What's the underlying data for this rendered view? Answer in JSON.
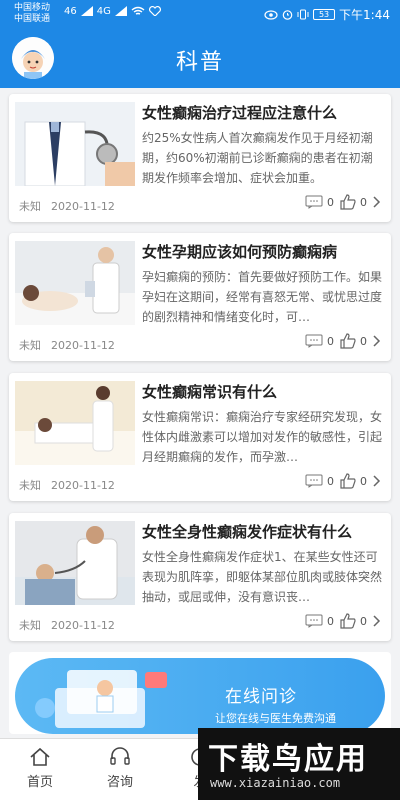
{
  "status_bar": {
    "carrier_1": "中国移动",
    "carrier_2": "中国联通",
    "signal_1": "46",
    "signal_2": "4G",
    "battery": "53",
    "time": "下午1:44"
  },
  "header": {
    "title": "科普"
  },
  "articles": [
    {
      "title": "女性癫痫治疗过程应注意什么",
      "summary": "约25%女性病人首次癫痫发作见于月经初潮期，约60%初潮前已诊断癫痫的患者在初潮期发作频率会增加、症状会加重。",
      "author": "未知",
      "date": "2020-11-12",
      "comments": "0",
      "likes": "0"
    },
    {
      "title": "女性孕期应该如何预防癫痫病",
      "summary": "孕妇癫痫的预防：首先要做好预防工作。如果孕妇在这期间，经常有喜怒无常、或忧思过度的剧烈精神和情绪变化时，可…",
      "author": "未知",
      "date": "2020-11-12",
      "comments": "0",
      "likes": "0"
    },
    {
      "title": "女性癫痫常识有什么",
      "summary": "女性癫痫常识：癫痫治疗专家经研究发现，女性体内雌激素可以增加对发作的敏感性，引起月经期癫痫的发作，而孕激…",
      "author": "未知",
      "date": "2020-11-12",
      "comments": "0",
      "likes": "0"
    },
    {
      "title": "女性全身性癫痫发作症状有什么",
      "summary": "女性全身性癫痫发作症状1、在某些女性还可表现为肌阵挛，即躯体某部位肌肉或肢体突然抽动，或屈或伸，没有意识丧…",
      "author": "未知",
      "date": "2020-11-12",
      "comments": "0",
      "likes": "0"
    }
  ],
  "banner": {
    "title": "在线问诊",
    "subtitle": "让您在线与医生免费沟通"
  },
  "bottom_nav": {
    "home": "首页",
    "consult": "咨询",
    "discover": "发"
  },
  "watermark": {
    "logo_text": "下载鸟应用",
    "url": "www.xiazainiao.com"
  },
  "colors": {
    "brand_blue": "#1e88e5",
    "watermark_green": "#3cd63c"
  }
}
